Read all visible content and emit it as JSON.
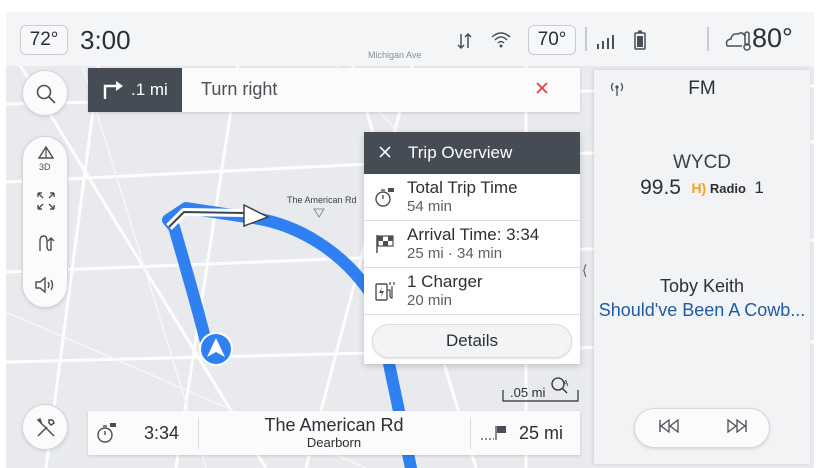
{
  "status_bar": {
    "cabin_temp_left": "72°",
    "clock": "3:00",
    "map_street_label": "Michigan Ave",
    "cabin_temp_right": "70°",
    "outside_temp": "80°"
  },
  "navigation": {
    "turn_distance": ".1 mi",
    "turn_instruction": "Turn right",
    "map_label": "The American Rd",
    "scale_label": ".05 mi"
  },
  "trip_overview": {
    "title": "Trip Overview",
    "rows": [
      {
        "label": "Total Trip Time",
        "value": "54 min",
        "icon": "stopwatch-flag-icon"
      },
      {
        "label": "Arrival Time: 3:34",
        "value": "25 mi · 34 min",
        "icon": "checkered-flag-icon"
      },
      {
        "label": "1 Charger",
        "value": "20 min",
        "icon": "charger-icon"
      }
    ],
    "details_button": "Details"
  },
  "bottom_bar": {
    "eta": "3:34",
    "destination_name": "The American Rd",
    "destination_city": "Dearborn",
    "distance_remaining": "25 mi"
  },
  "radio": {
    "band": "FM",
    "station_name": "WYCD",
    "frequency": "99.5",
    "hd_brand": "Radio",
    "hd_subchannel": "1",
    "artist": "Toby Keith",
    "song": "Should've Been A Cowb..."
  },
  "colors": {
    "route_blue": "#2f80f0",
    "banner_dark": "#454c56",
    "song_blue": "#1f5aa6",
    "hd_orange": "#f2a21b"
  }
}
